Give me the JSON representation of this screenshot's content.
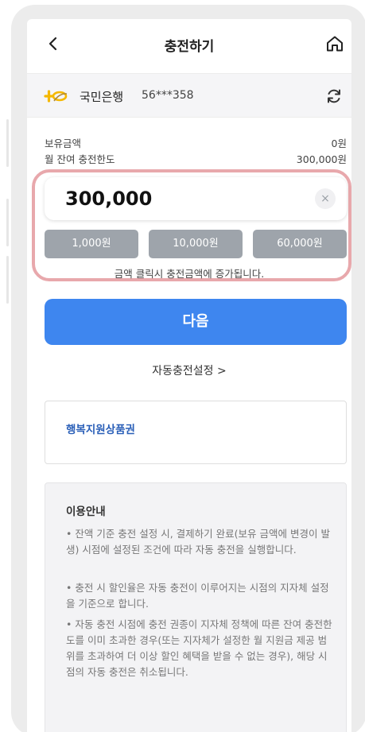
{
  "header": {
    "title": "충전하기"
  },
  "bank": {
    "name": "국민은행",
    "account": "56***358"
  },
  "balance": {
    "held_label": "보유금액",
    "held_value": "0원",
    "limit_label": "월 잔여 충전한도",
    "limit_value": "300,000원"
  },
  "amount": {
    "value": "300,000",
    "clear_symbol": "×"
  },
  "chips": [
    "1,000원",
    "10,000원",
    "60,000원"
  ],
  "hint": "금액 클릭시 충전금액에 증가됩니다.",
  "next_label": "다음",
  "auto_charge_label": "자동충전설정  >",
  "voucher_label": "행복지원상품권",
  "guide": {
    "title": "이용안내",
    "paragraphs": [
      "• 잔액 기준 충전 설정 시, 결제하기 완료(보유 금액에 변경이 발생) 시점에 설정된 조건에 따라 자동 충전을 실행합니다.",
      "• 충전 시 할인율은 자동 충전이 이루어지는 시점의 지자체 설정을 기준으로 합니다.",
      "• 자동 충전 시점에 충전 권종이 지자체 정책에 따른 잔여 충전한도를 이미 초과한 경우(또는 지자체가 설정한 월 지원금 제공 범위를 초과하여 더 이상 할인 혜택을 받을 수 없는 경우), 해당 시점의 자동 충전은 취소됩니다."
    ]
  },
  "colors": {
    "primary": "#3e86ef",
    "chip": "#9ea4ab",
    "highlight": "#e8a8ac",
    "voucher": "#2a5fb8",
    "kb_yellow": "#f5b800"
  },
  "icons": {
    "back": "chevron-left-icon",
    "home": "home-icon",
    "refresh": "refresh-icon",
    "clear": "clear-icon",
    "bank": "kb-logo-icon"
  }
}
